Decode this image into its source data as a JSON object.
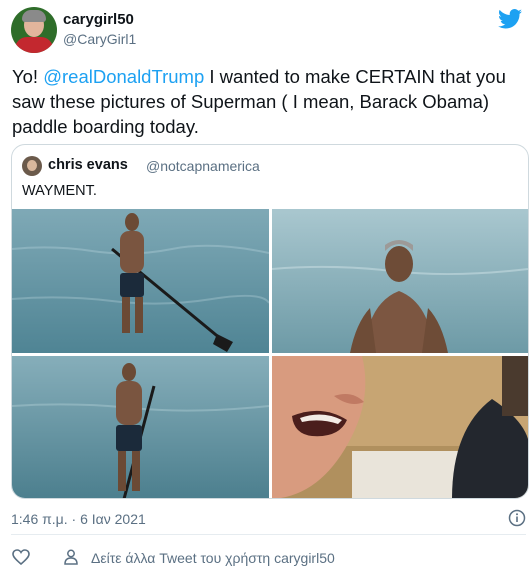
{
  "author": {
    "display_name": "carygirl50",
    "handle": "@CaryGirl1"
  },
  "tweet": {
    "text_before": "Yo! ",
    "mention": "@realDonaldTrump",
    "text_after": " I wanted to make CERTAIN that you saw these pictures of Superman ( I mean, Barack Obama) paddle boarding today."
  },
  "quoted": {
    "display_name": "chris evans",
    "handle": "@notcapnamerica",
    "text": "WAYMENT."
  },
  "footer": {
    "timestamp": "1:46 π.μ. · 6 Ιαν 2021",
    "see_more": "Δείτε άλλα Tweet του χρήστη carygirl50"
  },
  "icons": {
    "brand": "twitter-bird-icon",
    "info": "info-icon",
    "like": "heart-icon",
    "profile": "person-icon"
  },
  "colors": {
    "brand": "#1da1f2",
    "secondary_text": "#5b7083",
    "border": "#cfd9de"
  }
}
